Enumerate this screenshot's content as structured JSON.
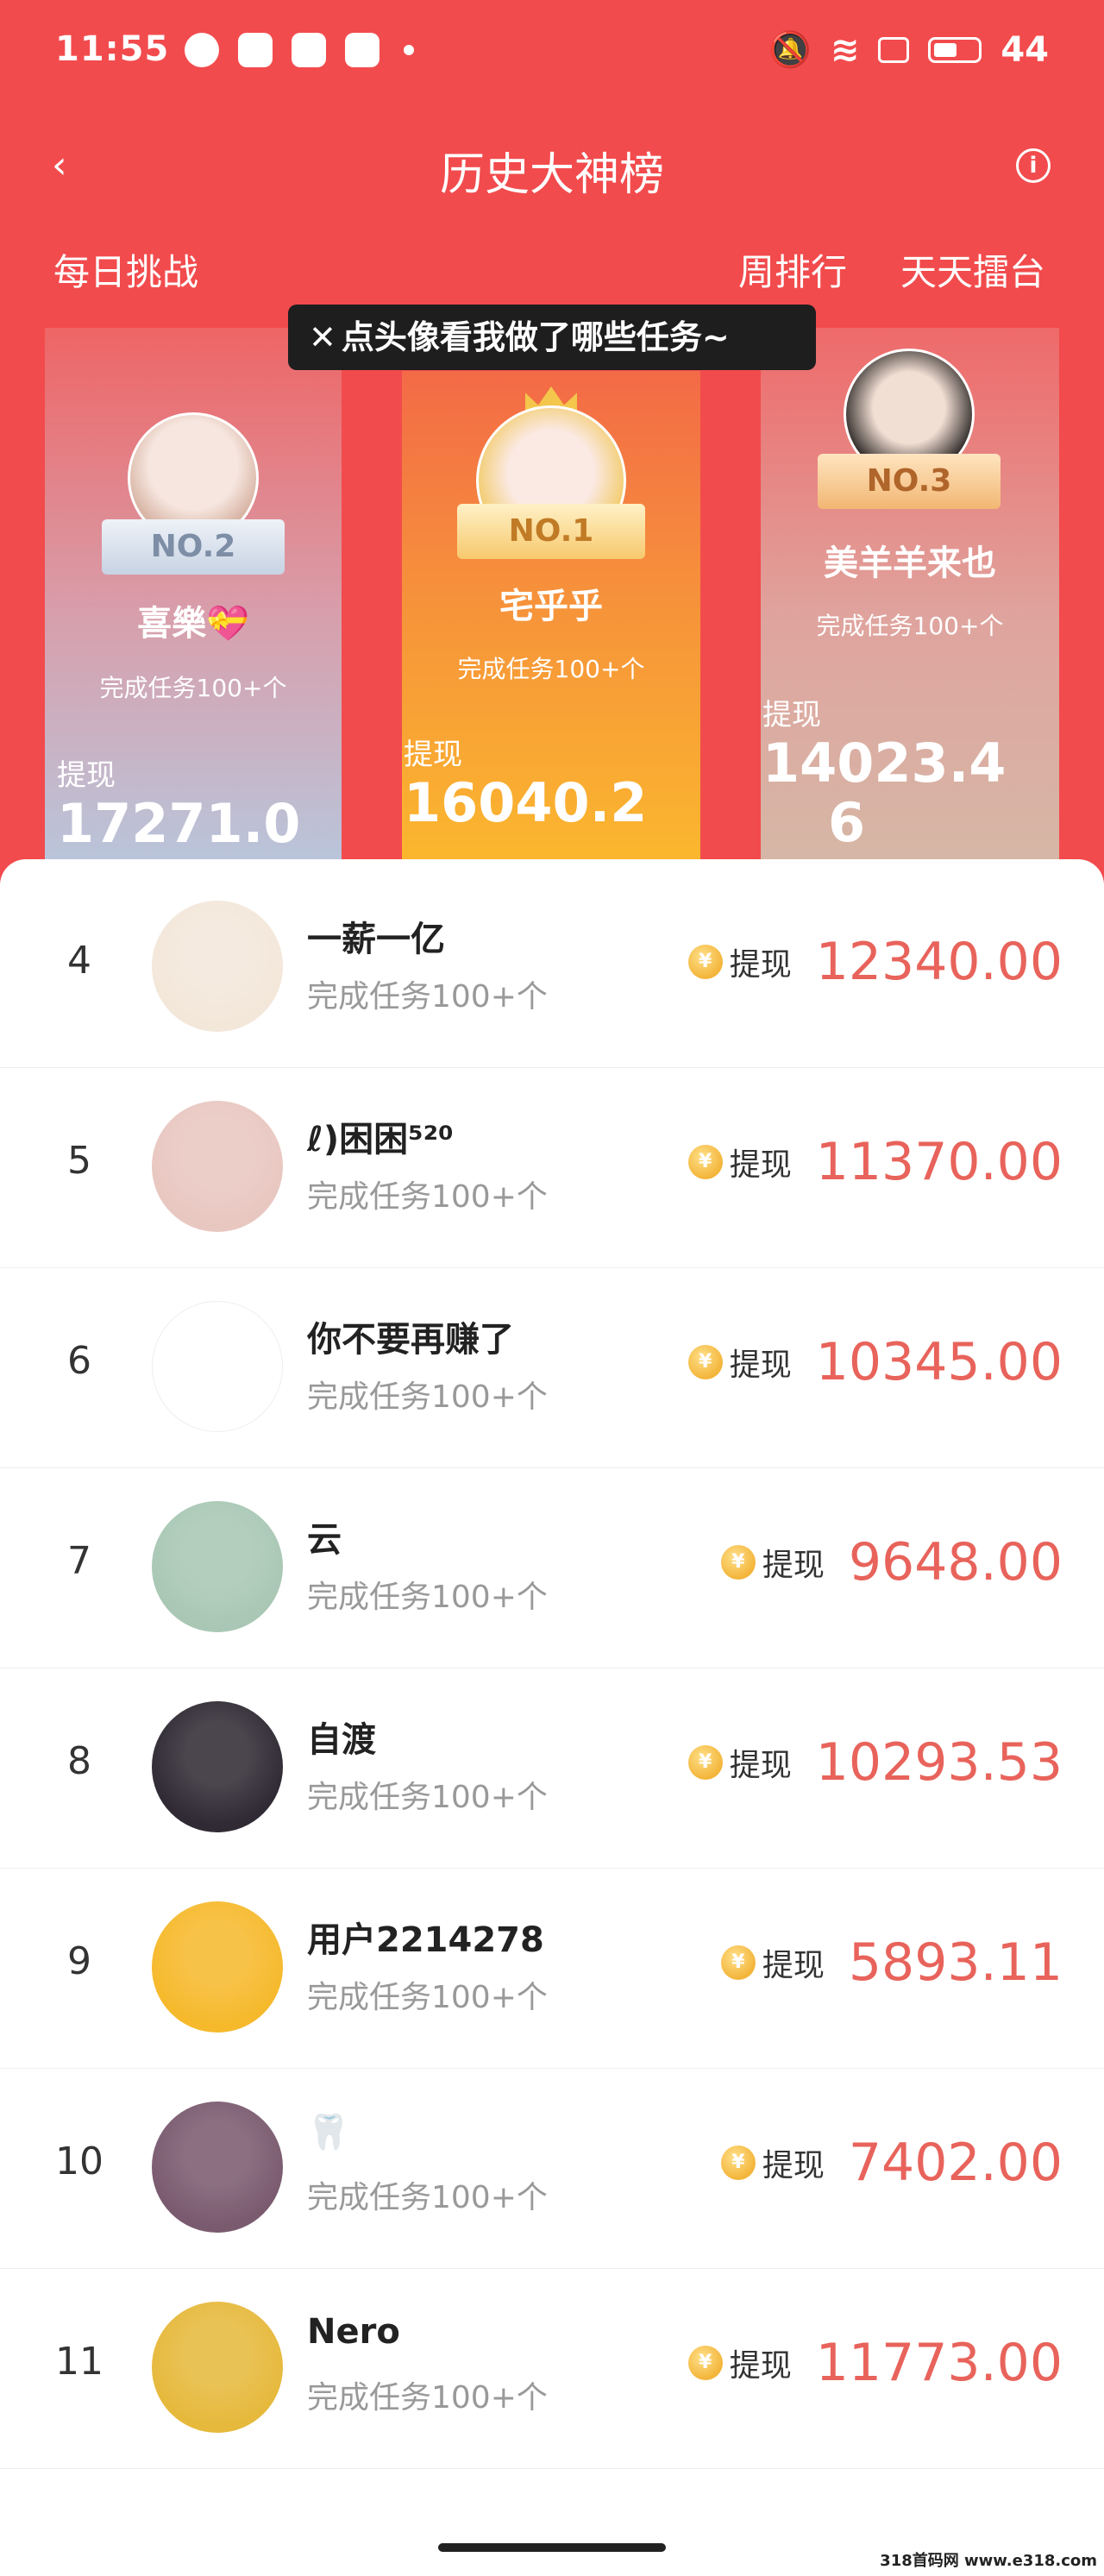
{
  "status_bar": {
    "time": "11:55",
    "battery": "44"
  },
  "nav": {
    "title": "历史大神榜"
  },
  "tabs": {
    "daily": "每日挑战",
    "weekly": "周排行",
    "arena": "天天擂台"
  },
  "tooltip": {
    "close": "✕",
    "text": "点头像看我做了哪些任务~"
  },
  "podium": {
    "first": {
      "badge": "NO.1",
      "name": "宅乎乎",
      "tasks": "完成任务100+个",
      "label": "提现",
      "amount": "16040.2"
    },
    "second": {
      "badge": "NO.2",
      "name": "喜樂💝",
      "tasks": "完成任务100+个",
      "label": "提现",
      "amount": "17271.0"
    },
    "third": {
      "badge": "NO.3",
      "name": "美羊羊来也",
      "tasks": "完成任务100+个",
      "label": "提现",
      "amount_line1": "14023.4",
      "amount_line2": "6"
    }
  },
  "list": [
    {
      "rank": "4",
      "name": "一薪一亿",
      "tasks": "完成任务100+个",
      "label": "提现",
      "amount": "12340.00",
      "avatar_color": "#f3e7da"
    },
    {
      "rank": "5",
      "name": "ℓ)困困⁵²⁰",
      "tasks": "完成任务100+个",
      "label": "提现",
      "amount": "11370.00",
      "avatar_color": "#e9c7c1"
    },
    {
      "rank": "6",
      "name": "你不要再赚了",
      "tasks": "完成任务100+个",
      "label": "提现",
      "amount": "10345.00",
      "avatar_color": "#ffffff"
    },
    {
      "rank": "7",
      "name": "云",
      "tasks": "完成任务100+个",
      "label": "提现",
      "amount": "9648.00",
      "avatar_color": "#a9c7b4"
    },
    {
      "rank": "8",
      "name": "自渡",
      "tasks": "完成任务100+个",
      "label": "提现",
      "amount": "10293.53",
      "avatar_color": "#2f2a33"
    },
    {
      "rank": "9",
      "name": "用户2214278",
      "tasks": "完成任务100+个",
      "label": "提现",
      "amount": "5893.11",
      "avatar_color": "#f6b92c"
    },
    {
      "rank": "10",
      "name": "🦷",
      "tasks": "完成任务100+个",
      "label": "提现",
      "amount": "7402.00",
      "avatar_color": "#7a5a6f"
    },
    {
      "rank": "11",
      "name": "Nero",
      "tasks": "完成任务100+个",
      "label": "提现",
      "amount": "11773.00",
      "avatar_color": "#e6b93c"
    }
  ],
  "coin_symbol": "¥",
  "watermark": "318首码网 www.e318.com",
  "colors": {
    "header_red": "#f24b4d",
    "amount_red": "#e8635b"
  }
}
